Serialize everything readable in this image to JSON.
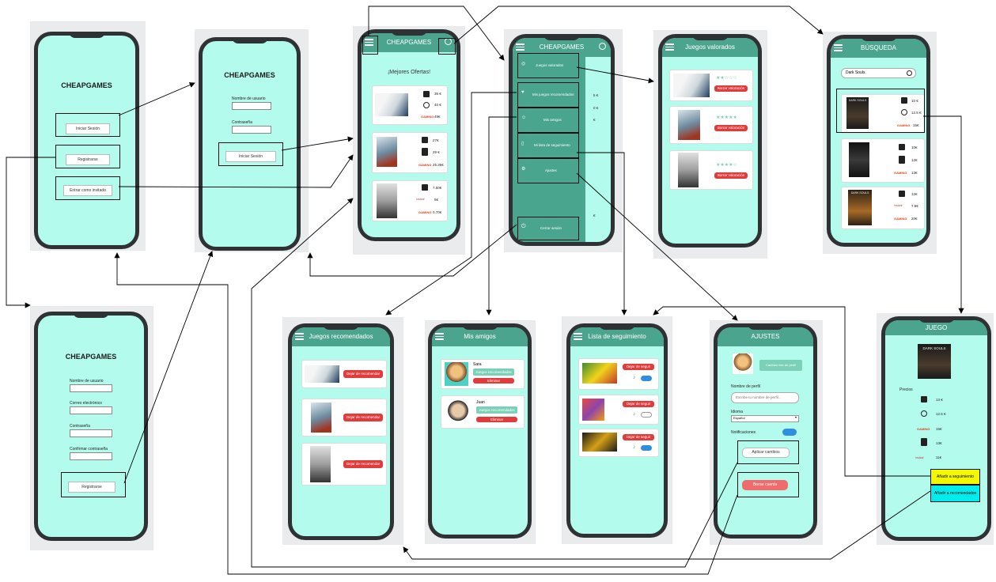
{
  "brand": "CHEAPGAMES",
  "login": {
    "start_btn": "Iniciar Sesión",
    "register_btn": "Registrarse",
    "guest_btn": "Entrar como invitado"
  },
  "signin": {
    "title": "CHEAPGAMES",
    "user_label": "Nombre de usuario",
    "pass_label": "Contraseña",
    "submit": "Iniciar Sesión"
  },
  "register": {
    "title": "CHEAPGAMES",
    "user_label": "Nombre de usuario",
    "email_label": "Correo electrónico",
    "pass_label": "Contraseña",
    "confirm_label": "Confirmar contraseña",
    "submit": "Registrarse"
  },
  "home": {
    "header": "CHEAPGAMES",
    "heading": "¡Mejores Ofertas!",
    "games": [
      {
        "prices": [
          "35 €",
          "40 €",
          "49€"
        ]
      },
      {
        "prices": [
          "27€",
          "29 €",
          "25.35€"
        ]
      },
      {
        "prices": [
          "7.50€",
          "5€",
          "0.70€"
        ]
      }
    ]
  },
  "drawer": {
    "header": "CHEAPGAMES",
    "items": [
      "Juegos valorados",
      "Mis juegos recomendados",
      "Mis amigos",
      "Mi lista de seguimiento",
      "Ajustes"
    ],
    "logout": "Cerrar sesión",
    "partial_prices": [
      "5 €",
      "0 €",
      "€",
      "€"
    ]
  },
  "rated": {
    "header": "Juegos valorados",
    "delete_btn": "Borrar valoración"
  },
  "search": {
    "header": "BÚSQUEDA",
    "query": "Dark Souls",
    "results": [
      {
        "title": "DARK SOULS",
        "prices": [
          "10 €",
          "12.5 €",
          "15€"
        ]
      },
      {
        "prices": [
          "10€",
          "12€",
          "13€"
        ]
      },
      {
        "title": "DARK SOULS",
        "prices": [
          "12€",
          "7.5€",
          "20€"
        ]
      }
    ]
  },
  "recommended": {
    "header": "Juegos recomendados",
    "btn": "Dejar de recomendar"
  },
  "friends": {
    "header": "Mis amigos",
    "list": [
      {
        "name": "Sara",
        "games_btn": "Juegos recomendados",
        "delete_btn": "Eliminar"
      },
      {
        "name": "Juan",
        "games_btn": "Juegos recomendados",
        "delete_btn": "Eliminar"
      }
    ]
  },
  "watchlist": {
    "header": "Lista de seguimiento",
    "btn": "Dejar de seguir"
  },
  "settings": {
    "header": "AJUSTES",
    "change_photo": "Cambiar foto de perfil",
    "name_label": "Nombre de perfil",
    "name_placeholder": "Escribe tu nombre de perfil...",
    "lang_label": "Idioma",
    "lang_value": "Español",
    "notif_label": "Notificaciones",
    "apply_btn": "Aplicar cambios",
    "delete_btn": "Borrar cuenta"
  },
  "game": {
    "header": "JUEGO",
    "cover_title": "DARK SOULS",
    "prices_label": "Precios",
    "prices": [
      "13 €",
      "12.5 €",
      "15€",
      "13€",
      "11€"
    ],
    "add_watch": "Añadir a seguimiento",
    "add_rec": "Añadir a recomendados"
  },
  "colors": {
    "screen": "#b3fbec",
    "header": "#4ba58e",
    "red": "#e23b3b",
    "phone": "#2f3235",
    "yellow": "#f3f700",
    "cyan": "#00eded"
  },
  "icons": [
    "menu-icon",
    "search-icon",
    "steam-icon",
    "epic-icon",
    "power-icon",
    "bell-icon",
    "star-icon"
  ]
}
